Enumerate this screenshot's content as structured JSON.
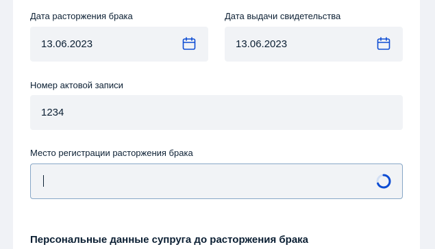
{
  "form": {
    "divorce_date": {
      "label": "Дата расторжения брака",
      "value": "13.06.2023",
      "icon": "calendar-icon"
    },
    "certificate_date": {
      "label": "Дата выдачи свидетельства",
      "value": "13.06.2023",
      "icon": "calendar-icon"
    },
    "record_number": {
      "label": "Номер актовой записи",
      "value": "1234"
    },
    "registration_place": {
      "label": "Место регистрации расторжения брака",
      "value": "",
      "icon": "loading-spinner-icon"
    },
    "section_title": "Персональные данные супруга до расторжения брака"
  },
  "colors": {
    "page_bg": "#f0f2f6",
    "card_bg": "#ffffff",
    "field_bg": "#f1f3f6",
    "text": "#0b1f33",
    "accent": "#0d4cd3",
    "focus_border": "#86a6c6"
  }
}
